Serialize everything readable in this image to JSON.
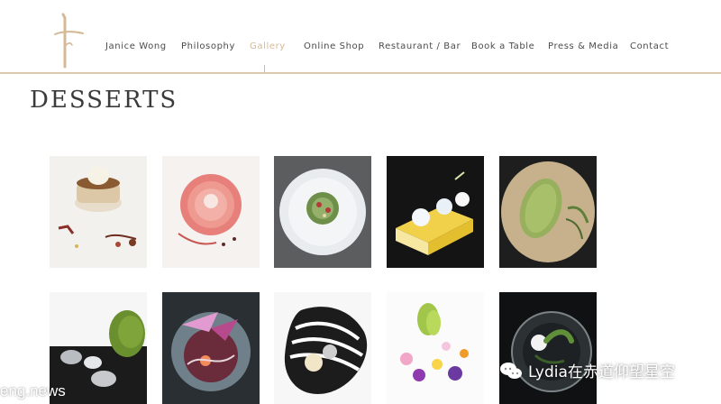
{
  "nav": {
    "items": [
      {
        "label": "Janice Wong"
      },
      {
        "label": "Philosophy"
      },
      {
        "label": "Gallery",
        "active": true
      },
      {
        "label": "Online Shop"
      },
      {
        "label": "Restaurant / Bar"
      },
      {
        "label": "Book a Table"
      },
      {
        "label": "Press & Media"
      },
      {
        "label": "Contact"
      }
    ]
  },
  "page": {
    "title": "DESSERTS"
  },
  "gallery": {
    "row1": [
      {
        "icon": "tart-dessert-photo"
      },
      {
        "icon": "pink-rose-dessert-photo"
      },
      {
        "icon": "plated-green-dessert-photo"
      },
      {
        "icon": "yellow-cube-dessert-photo"
      },
      {
        "icon": "green-pod-dessert-photo"
      }
    ],
    "row2": [
      {
        "icon": "stones-matcha-dessert-photo"
      },
      {
        "icon": "purple-petals-dessert-photo"
      },
      {
        "icon": "striped-plate-dessert-photo"
      },
      {
        "icon": "flower-garden-dessert-photo"
      },
      {
        "icon": "glass-plate-dessert-photo"
      }
    ]
  },
  "watermark": {
    "left_text": "eng.news",
    "right_text": "Lydia在赤道仰望星空"
  },
  "colors": {
    "accent": "#d5b896",
    "nav_text": "#4b4b4b",
    "title_text": "#3b3b3b",
    "rule": "#d9c9ad"
  }
}
